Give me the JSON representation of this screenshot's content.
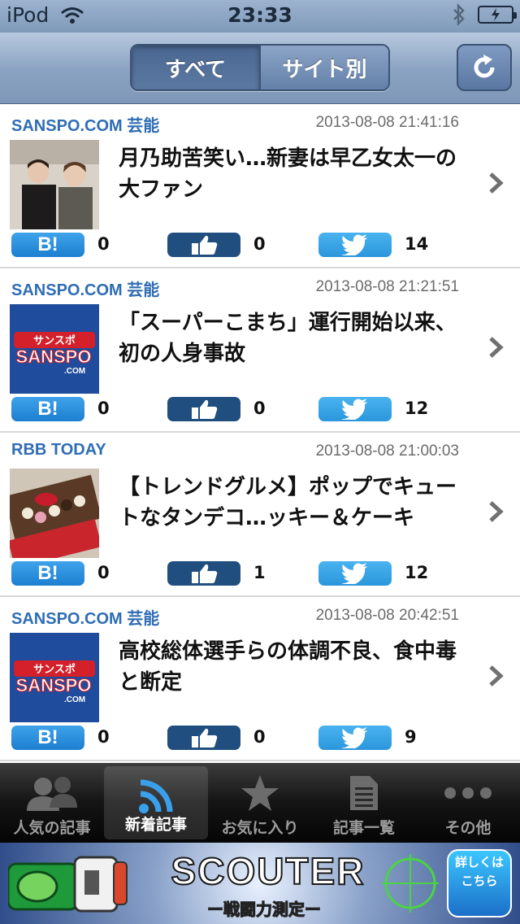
{
  "status": {
    "carrier": "iPod",
    "time": "23:33"
  },
  "nav": {
    "segments": [
      "すべて",
      "サイト別"
    ],
    "active_segment": 0
  },
  "feed": [
    {
      "source": "SANSPO.COM 芸能",
      "date": "2013-08-08 21:41:16",
      "title": "月乃助苦笑い…新妻は早乙女太一の大ファン",
      "hatena": "0",
      "likes": "0",
      "tweets": "14",
      "thumb": "photo-people"
    },
    {
      "source": "SANSPO.COM 芸能",
      "date": "2013-08-08 21:21:51",
      "title": "「スーパーこまち」運行開始以来、初の人身事故",
      "hatena": "0",
      "likes": "0",
      "tweets": "12",
      "thumb": "sanspo-logo"
    },
    {
      "source": "RBB TODAY",
      "date": "2013-08-08 21:00:03",
      "title": "【トレンドグルメ】ポップでキュートなタンデコ…ッキー＆ケーキ",
      "hatena": "0",
      "likes": "1",
      "tweets": "12",
      "thumb": "photo-cookies"
    },
    {
      "source": "SANSPO.COM 芸能",
      "date": "2013-08-08 20:42:51",
      "title": "高校総体選手らの体調不良、食中毒と断定",
      "hatena": "0",
      "likes": "0",
      "tweets": "9",
      "thumb": "sanspo-logo"
    }
  ],
  "sanspo_logo": {
    "top": "サンスポ",
    "main": "SANSPO",
    "sub": ".COM"
  },
  "hatena_label": "B!",
  "tabs": [
    {
      "label": "人気の記事",
      "icon": "people-icon"
    },
    {
      "label": "新着記事",
      "icon": "rss-icon"
    },
    {
      "label": "お気に入り",
      "icon": "star-icon"
    },
    {
      "label": "記事一覧",
      "icon": "document-icon"
    },
    {
      "label": "その他",
      "icon": "more-icon"
    }
  ],
  "active_tab": 1,
  "ad": {
    "title": "SCOUTER",
    "subtitle": "ー戦闘力測定ー",
    "detail_line1": "詳しくは",
    "detail_line2": "こちら"
  },
  "colors": {
    "source_text": "#2f6db5",
    "hatena_blue": "#1c7fd0",
    "like_navy": "#204e7f",
    "twitter_blue": "#2a96db",
    "nav_bar": "#8ca4c3"
  }
}
